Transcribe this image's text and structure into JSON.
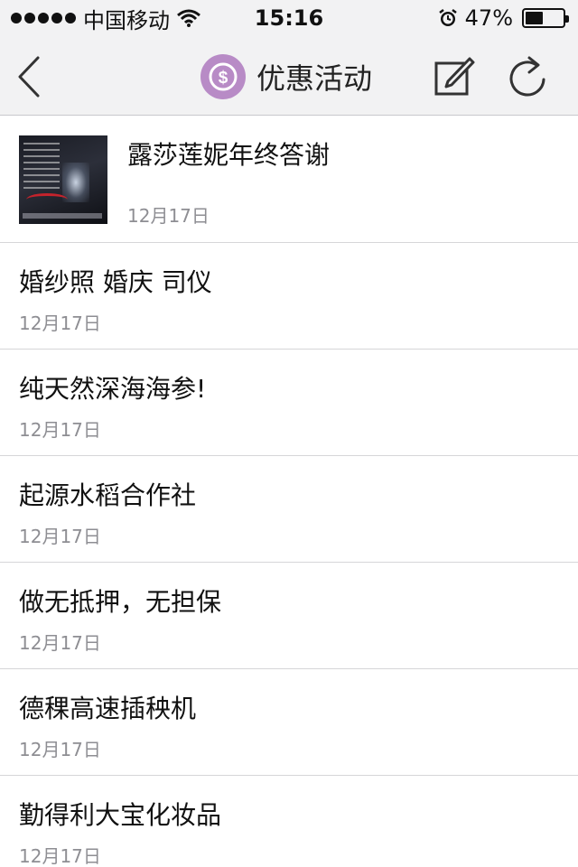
{
  "status_bar": {
    "carrier": "中国移动",
    "time": "15:16",
    "battery_text": "47%",
    "battery_level": 0.47,
    "icons": [
      "signal-dots-icon",
      "wifi-icon",
      "alarm-icon",
      "battery-icon"
    ]
  },
  "navbar": {
    "title": "优惠活动",
    "title_icon": "coin-dollar-icon",
    "icon_color": "#b88bc6",
    "back_icon": "chevron-left-icon",
    "edit_icon": "compose-icon",
    "refresh_icon": "refresh-icon"
  },
  "list": {
    "items": [
      {
        "title": "露莎莲妮年终答谢",
        "date": "12月17日"
      },
      {
        "title": "婚纱照 婚庆 司仪",
        "date": "12月17日"
      },
      {
        "title": "纯天然深海海参!",
        "date": "12月17日"
      },
      {
        "title": "起源水稻合作社",
        "date": "12月17日"
      },
      {
        "title": "做无抵押，无担保",
        "date": "12月17日"
      },
      {
        "title": "德稞高速插秧机",
        "date": "12月17日"
      },
      {
        "title": "勤得利大宝化妆品",
        "date": "12月17日"
      }
    ]
  }
}
